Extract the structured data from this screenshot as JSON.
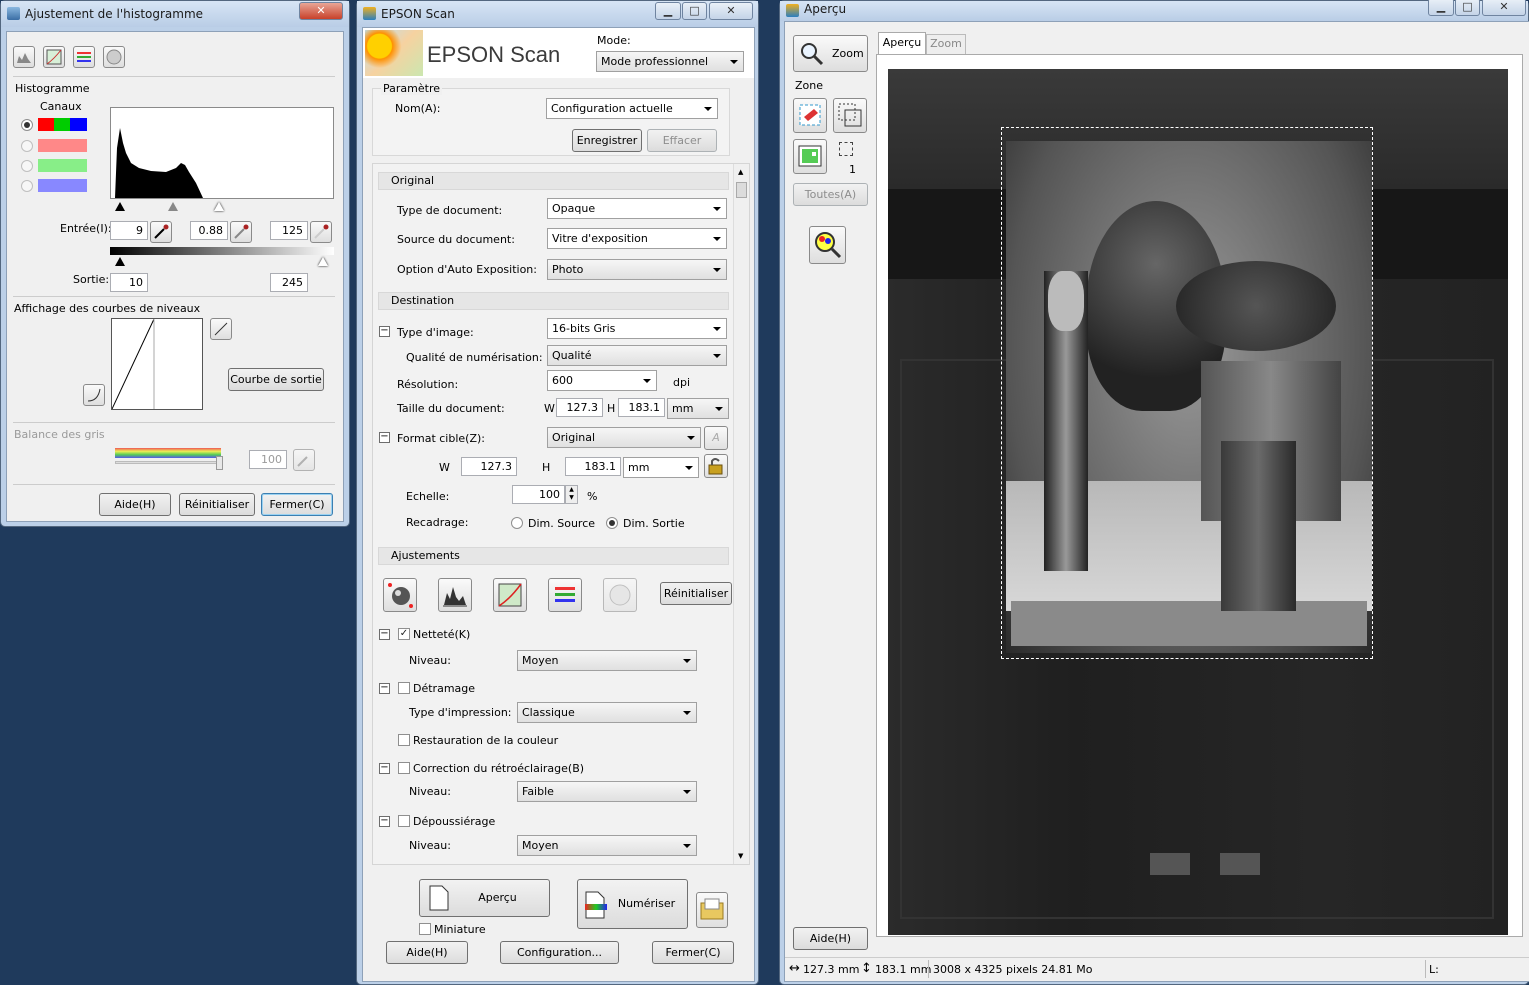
{
  "histogram_window": {
    "title": "Ajustement de l'histogramme",
    "section": "Histogramme",
    "channels_label": "Canaux",
    "input_label": "Entrée(I):",
    "input_black": "9",
    "input_gamma": "0.88",
    "input_white": "125",
    "output_label": "Sortie:",
    "output_black": "10",
    "output_white": "245",
    "curve_label": "Affichage des courbes de niveaux",
    "output_curve_button": "Courbe de sortie",
    "gray_balance_label": "Balance des gris",
    "gray_balance_value": "100",
    "help_button": "Aide(H)",
    "reset_button": "Réinitialiser",
    "close_button": "Fermer(C)"
  },
  "epson_window": {
    "title": "EPSON Scan",
    "logo": "EPSON Scan",
    "mode_label": "Mode:",
    "mode_value": "Mode professionnel",
    "settings": {
      "group": "Paramètre",
      "name_label": "Nom(A):",
      "name_value": "Configuration actuelle",
      "save_button": "Enregistrer",
      "delete_button": "Effacer"
    },
    "original": {
      "header": "Original",
      "doc_type_label": "Type de document:",
      "doc_type": "Opaque",
      "doc_source_label": "Source du document:",
      "doc_source": "Vitre d'exposition",
      "auto_exposure_label": "Option d'Auto Exposition:",
      "auto_exposure": "Photo"
    },
    "destination": {
      "header": "Destination",
      "image_type_label": "Type d'image:",
      "image_type": "16-bits Gris",
      "quality_label": "Qualité de numérisation:",
      "quality": "Qualité",
      "resolution_label": "Résolution:",
      "resolution": "600",
      "resolution_unit": "dpi",
      "doc_size_label": "Taille du document:",
      "w_label": "W",
      "w_value": "127.3",
      "h_label": "H",
      "h_value": "183.1",
      "size_unit": "mm",
      "target_label": "Format cible(Z):",
      "target": "Original",
      "tw": "127.3",
      "th": "183.1",
      "tunit": "mm",
      "scale_label": "Echelle:",
      "scale": "100",
      "scale_unit": "%",
      "trim_label": "Recadrage:",
      "trim_source": "Dim. Source",
      "trim_output": "Dim. Sortie"
    },
    "adjustments": {
      "header": "Ajustements",
      "reset_button": "Réinitialiser",
      "sharpness_label": "Netteté(K)",
      "sharpness_level_label": "Niveau:",
      "sharpness_level": "Moyen",
      "descreen_label": "Détramage",
      "print_type_label": "Type d'impression:",
      "print_type": "Classique",
      "color_restore_label": "Restauration de la couleur",
      "backlight_label": "Correction du rétroéclairage(B)",
      "backlight_level_label": "Niveau:",
      "backlight_level": "Faible",
      "dust_label": "Dépoussiérage",
      "dust_level_label": "Niveau:",
      "dust_level": "Moyen"
    },
    "preview_button": "Aperçu",
    "thumbnail_label": "Miniature",
    "scan_button": "Numériser",
    "help_button": "Aide(H)",
    "config_button": "Configuration...",
    "close_button": "Fermer(C)"
  },
  "preview_window": {
    "title": "Aperçu",
    "zoom_button": "Zoom",
    "zone_label": "Zone",
    "zone_count": "1",
    "all_button": "Toutes(A)",
    "tab_preview": "Aperçu",
    "tab_zoom": "Zoom",
    "help_button": "Aide(H)",
    "status_width": "127.3 mm",
    "status_height": "183.1 mm",
    "status_pixels": "3008 x 4325 pixels 24.81 Mo",
    "status_l": "L:"
  }
}
